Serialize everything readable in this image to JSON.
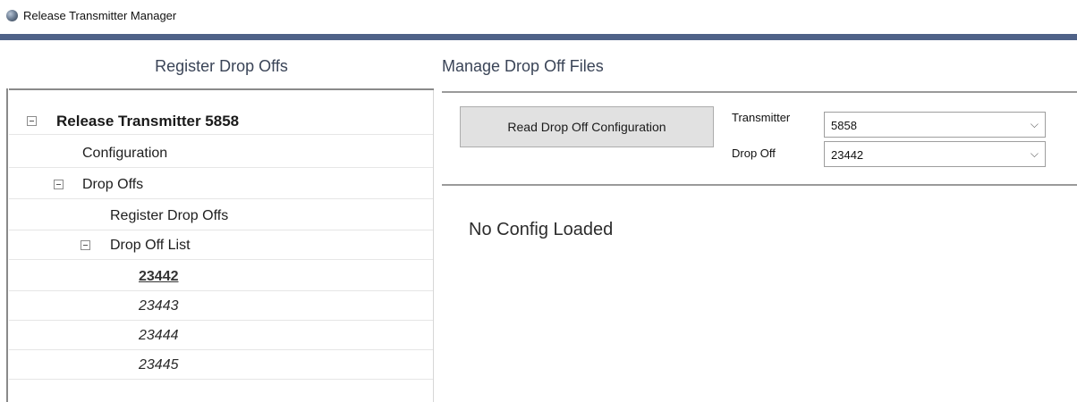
{
  "window": {
    "title": "Release Transmitter Manager",
    "icon": "globe-icon"
  },
  "left_panel": {
    "header": "Register Drop Offs"
  },
  "tree": {
    "root_label": "Release Transmitter 5858",
    "configuration": "Configuration",
    "drop_offs": "Drop Offs",
    "register_drop_offs": "Register Drop Offs",
    "drop_off_list": "Drop Off List",
    "items": [
      "23442",
      "23443",
      "23444",
      "23445"
    ],
    "selected_item": "23442"
  },
  "right_panel": {
    "header": "Manage Drop Off Files",
    "read_button": "Read Drop Off Configuration",
    "transmitter_label": "Transmitter",
    "transmitter_value": "5858",
    "drop_off_label": "Drop Off",
    "drop_off_value": "23442",
    "dropdown_arrow": "⌵",
    "status": "No Config Loaded"
  },
  "colors": {
    "accent_bar": "#4f6288",
    "header_text": "#3a4457",
    "button_bg": "#e1e1e1"
  }
}
